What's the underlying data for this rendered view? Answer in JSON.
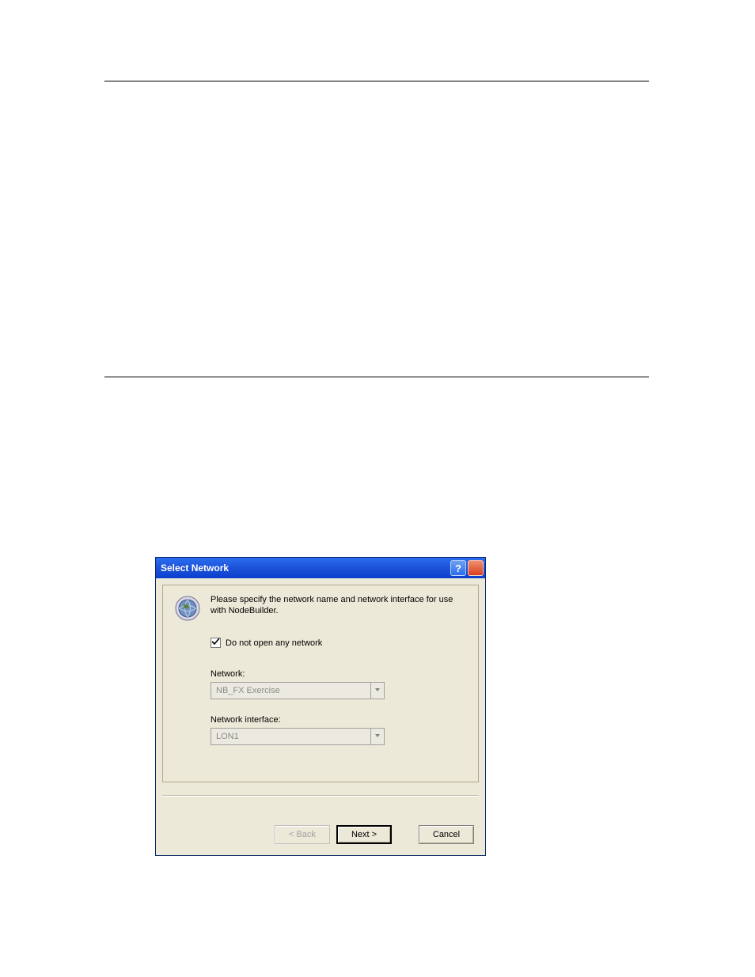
{
  "dialog": {
    "title": "Select Network",
    "instruction": "Please specify the network name and network interface for use with NodeBuilder.",
    "checkbox": {
      "label": "Do not open any network",
      "checked": true
    },
    "network": {
      "label": "Network:",
      "value": "NB_FX Exercise"
    },
    "interface": {
      "label": "Network interface:",
      "value": "LON1"
    },
    "buttons": {
      "back": "< Back",
      "next": "Next >",
      "cancel": "Cancel"
    }
  }
}
